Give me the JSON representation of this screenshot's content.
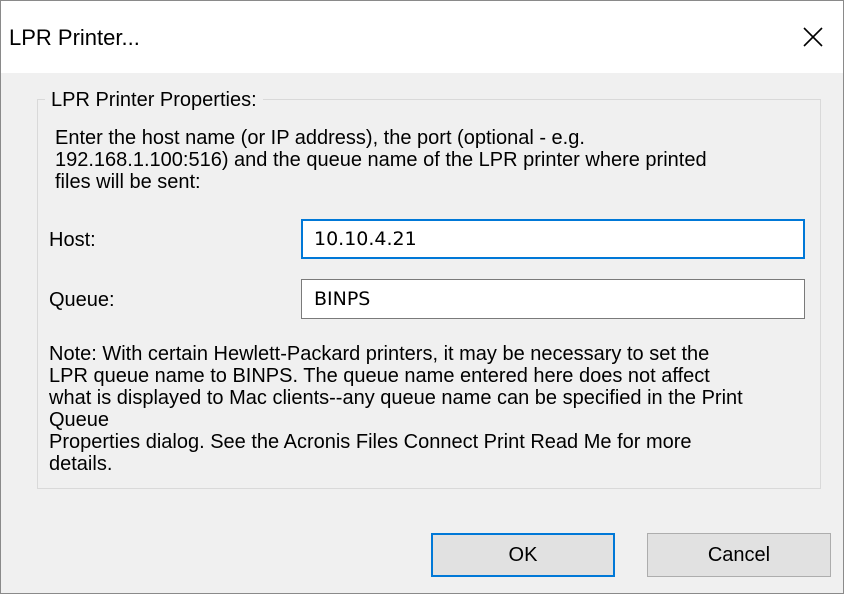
{
  "window": {
    "title": "LPR Printer...",
    "close_icon": "close-icon"
  },
  "group": {
    "label": "LPR Printer Properties:",
    "description": "Enter the host name (or IP address), the port (optional - e.g.\n192.168.1.100:516) and the queue name of the LPR printer where printed\nfiles will be sent:"
  },
  "host": {
    "label": "Host:",
    "value": "10.10.4.21"
  },
  "queue": {
    "label": "Queue:",
    "value": "BINPS"
  },
  "note": "Note: With certain Hewlett-Packard printers, it may be necessary to set the\nLPR queue name to BINPS.  The queue name entered here does not affect\nwhat is displayed to Mac clients--any queue name can be specified in the Print\nQueue\nProperties dialog.  See the Acronis Files Connect Print Read Me for more\ndetails.",
  "buttons": {
    "ok": "OK",
    "cancel": "Cancel"
  },
  "colors": {
    "focus_accent": "#0078d7",
    "dialog_bg": "#f0f0f0"
  }
}
